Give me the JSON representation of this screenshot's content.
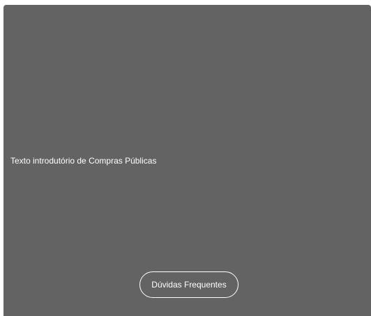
{
  "panel": {
    "intro_text": "Texto introdutório de Compras Públicas",
    "faq_button_label": "Dúvidas Frequentes"
  },
  "colors": {
    "panel_background": "#636363",
    "text": "#ffffff",
    "button_border": "#ffffff"
  }
}
